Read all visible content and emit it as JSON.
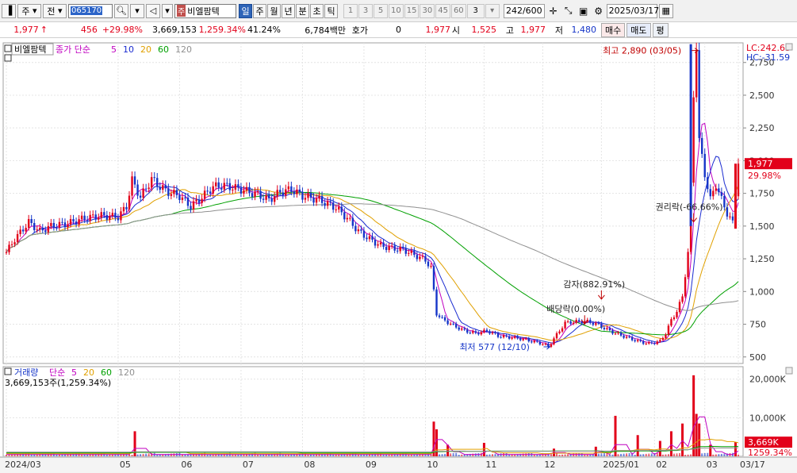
{
  "toolbar": {
    "market_select": "주",
    "market_select2": "전",
    "stock_code": "065170",
    "stock_badge": "주",
    "stock_name": "비엘팜텍",
    "periods": [
      "일",
      "주",
      "월",
      "년",
      "분",
      "초",
      "틱"
    ],
    "active_period": "일",
    "intervals": [
      "1",
      "3",
      "5",
      "10",
      "15",
      "30",
      "45",
      "60"
    ],
    "interval_select": "3",
    "count_display": "242/600",
    "date": "2025/03/17"
  },
  "info": {
    "price": "1,977",
    "price_arrow": "↑",
    "change": "456",
    "change_pct": "+29.98%",
    "volume": "3,669,153",
    "volume_pct": "1,259.34%",
    "turnover": "41.24%",
    "amount": "6,784백만",
    "quote_label": "호가",
    "quote_value": "0",
    "quote_price": "1,977",
    "open_label": "시",
    "open_value": "1,525",
    "high_label": "고",
    "high_value": "1,977",
    "low_label": "저",
    "low_value": "1,480",
    "buy_button": "매수",
    "sell_button": "매도",
    "eval_button": "평"
  },
  "chart_data": [
    {
      "type": "candlestick",
      "title": "비엘팜텍",
      "legend_label": "종가 단순",
      "ma_periods": [
        "5",
        "10",
        "20",
        "60",
        "120"
      ],
      "ma_colors": [
        "#c000c0",
        "#1a2bd0",
        "#e0a000",
        "#00a000",
        "#909090"
      ],
      "lc_label": "LC:242.63",
      "hc_label": "HC:-31.59",
      "ylim": [
        450,
        2900
      ],
      "yticks": [
        500,
        750,
        1000,
        1250,
        1500,
        1750,
        2000,
        2250,
        2500,
        2750
      ],
      "ytick_labels": [
        "500",
        "750",
        "1,000",
        "1,250",
        "1,500",
        "1,750",
        "2,000",
        "2,250",
        "2,500",
        "2,750"
      ],
      "current_price_label": "1,977",
      "current_pct_label": "29.98%",
      "current_price": 1977,
      "prev_close": 1521,
      "x_labels": [
        "2024/03",
        "05",
        "06",
        "07",
        "08",
        "09",
        "10",
        "11",
        "12",
        "2025/01",
        "02",
        "03",
        "03/17"
      ],
      "x_label_days": [
        0,
        40,
        62,
        84,
        106,
        128,
        150,
        171,
        192,
        213,
        232,
        250,
        262
      ],
      "total_days": 262,
      "annotations": [
        {
          "text": "최고 2,890 (03/05)",
          "day": 247,
          "value": 2860
        },
        {
          "text": "권리락(-66.66%)",
          "day": 246,
          "value": 1550
        },
        {
          "text": "감자(882.91%)",
          "day": 213,
          "value": 960
        },
        {
          "text": "배당락(0.00%)",
          "day": 207,
          "value": 770
        },
        {
          "text": "최저 577 (12/10)",
          "day": 194,
          "value": 577
        }
      ],
      "price_path": [
        [
          0,
          1300
        ],
        [
          3,
          1400
        ],
        [
          8,
          1530
        ],
        [
          12,
          1460
        ],
        [
          16,
          1500
        ],
        [
          22,
          1520
        ],
        [
          28,
          1560
        ],
        [
          34,
          1580
        ],
        [
          40,
          1570
        ],
        [
          43,
          1650
        ],
        [
          45,
          1850
        ],
        [
          48,
          1720
        ],
        [
          52,
          1860
        ],
        [
          55,
          1800
        ],
        [
          58,
          1760
        ],
        [
          62,
          1730
        ],
        [
          66,
          1650
        ],
        [
          70,
          1720
        ],
        [
          74,
          1800
        ],
        [
          78,
          1810
        ],
        [
          84,
          1780
        ],
        [
          90,
          1740
        ],
        [
          94,
          1700
        ],
        [
          98,
          1760
        ],
        [
          102,
          1780
        ],
        [
          106,
          1730
        ],
        [
          112,
          1700
        ],
        [
          118,
          1640
        ],
        [
          122,
          1560
        ],
        [
          126,
          1460
        ],
        [
          130,
          1400
        ],
        [
          134,
          1350
        ],
        [
          138,
          1330
        ],
        [
          142,
          1320
        ],
        [
          146,
          1280
        ],
        [
          150,
          1240
        ],
        [
          152,
          1180
        ],
        [
          154,
          830
        ],
        [
          156,
          790
        ],
        [
          160,
          740
        ],
        [
          164,
          700
        ],
        [
          168,
          680
        ],
        [
          172,
          700
        ],
        [
          176,
          660
        ],
        [
          180,
          650
        ],
        [
          184,
          640
        ],
        [
          188,
          620
        ],
        [
          192,
          600
        ],
        [
          194,
          577
        ],
        [
          196,
          640
        ],
        [
          200,
          760
        ],
        [
          204,
          770
        ],
        [
          208,
          770
        ],
        [
          212,
          745
        ],
        [
          214,
          720
        ],
        [
          218,
          680
        ],
        [
          222,
          650
        ],
        [
          226,
          620
        ],
        [
          230,
          600
        ],
        [
          234,
          620
        ],
        [
          236,
          680
        ],
        [
          238,
          780
        ],
        [
          240,
          850
        ],
        [
          242,
          960
        ],
        [
          244,
          1300
        ],
        [
          245,
          1800
        ],
        [
          246,
          2500
        ],
        [
          247,
          2890
        ],
        [
          248,
          2150
        ],
        [
          250,
          1900
        ],
        [
          252,
          1700
        ],
        [
          254,
          1820
        ],
        [
          256,
          1700
        ],
        [
          258,
          1600
        ],
        [
          260,
          1521
        ],
        [
          262,
          1977
        ]
      ],
      "volume_panel": {
        "label": "거래량",
        "ma_label": "단순",
        "ma_periods": [
          "5",
          "20",
          "60",
          "120"
        ],
        "ma_colors": [
          "#c000c0",
          "#e0a000",
          "#00a000",
          "#909090"
        ],
        "current_text": "3,669,153주(1,259.34%)",
        "ylim": [
          0,
          22000
        ],
        "yticks": [
          10000,
          20000
        ],
        "ytick_labels": [
          "10,000K",
          "20,000K"
        ],
        "current_volume_label": "3,669K",
        "current_pct_label": "1259.34%",
        "spikes": [
          {
            "day": 46,
            "value": 6500
          },
          {
            "day": 153,
            "value": 9000
          },
          {
            "day": 154,
            "value": 7000
          },
          {
            "day": 158,
            "value": 3000
          },
          {
            "day": 171,
            "value": 3500
          },
          {
            "day": 196,
            "value": 2000
          },
          {
            "day": 211,
            "value": 2500
          },
          {
            "day": 218,
            "value": 10500
          },
          {
            "day": 226,
            "value": 5500
          },
          {
            "day": 234,
            "value": 4000
          },
          {
            "day": 238,
            "value": 6500
          },
          {
            "day": 242,
            "value": 8500
          },
          {
            "day": 246,
            "value": 21000
          },
          {
            "day": 247,
            "value": 11000
          },
          {
            "day": 248,
            "value": 8500
          },
          {
            "day": 252,
            "value": 3000
          },
          {
            "day": 261,
            "value": 3669
          }
        ]
      }
    }
  ]
}
